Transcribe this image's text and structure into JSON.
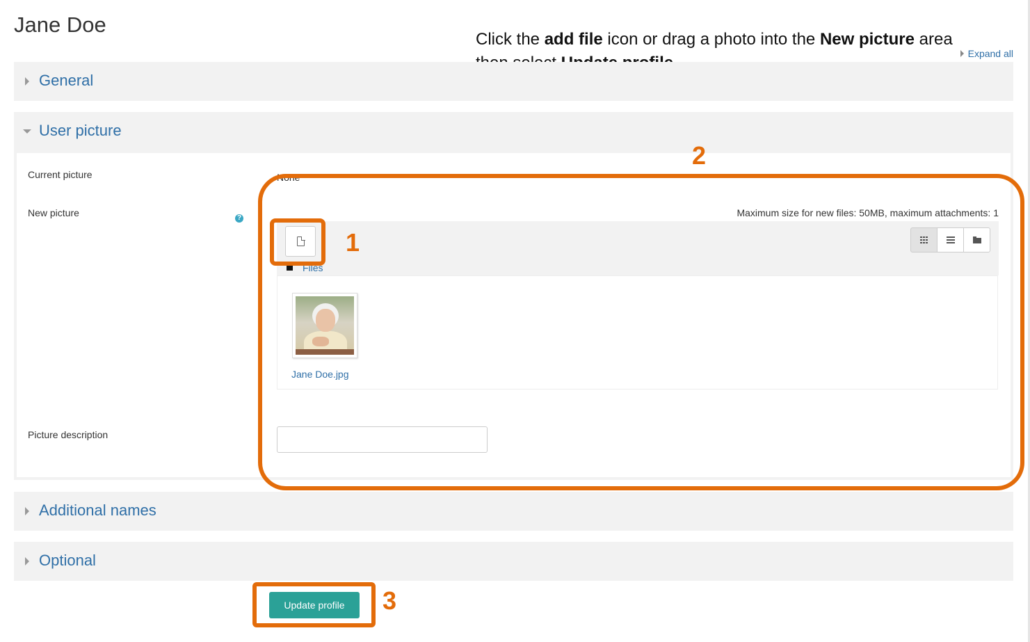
{
  "page": {
    "title": "Jane Doe",
    "expand_all": "Expand all"
  },
  "instruction": {
    "p1": "Click the ",
    "b1": "add file",
    "p2": " icon or drag a photo into the ",
    "b2": "New picture",
    "p3": " area then select ",
    "b3": "Update profile"
  },
  "sections": {
    "general": "General",
    "user_picture": "User picture",
    "additional_names": "Additional names",
    "optional": "Optional"
  },
  "user_picture": {
    "current_label": "Current picture",
    "current_value": "None",
    "new_label": "New picture",
    "help_glyph": "?",
    "max_size": "Maximum size for new files: 50MB, maximum attachments: 1",
    "files_crumb": "Files",
    "file_name": "Jane Doe.jpg",
    "description_label": "Picture description",
    "description_value": ""
  },
  "submit": {
    "label": "Update profile"
  },
  "callouts": [
    "1",
    "2",
    "3"
  ],
  "icons": {
    "add_file": "file-icon",
    "view_icons": "grid-icon",
    "view_list": "list-icon",
    "view_tree": "folder-icon",
    "help": "help-icon"
  },
  "colors": {
    "link": "#2f6fa7",
    "section_bg": "#f2f2f2",
    "primary_button": "#2ba197",
    "callout": "#e36c0a"
  }
}
